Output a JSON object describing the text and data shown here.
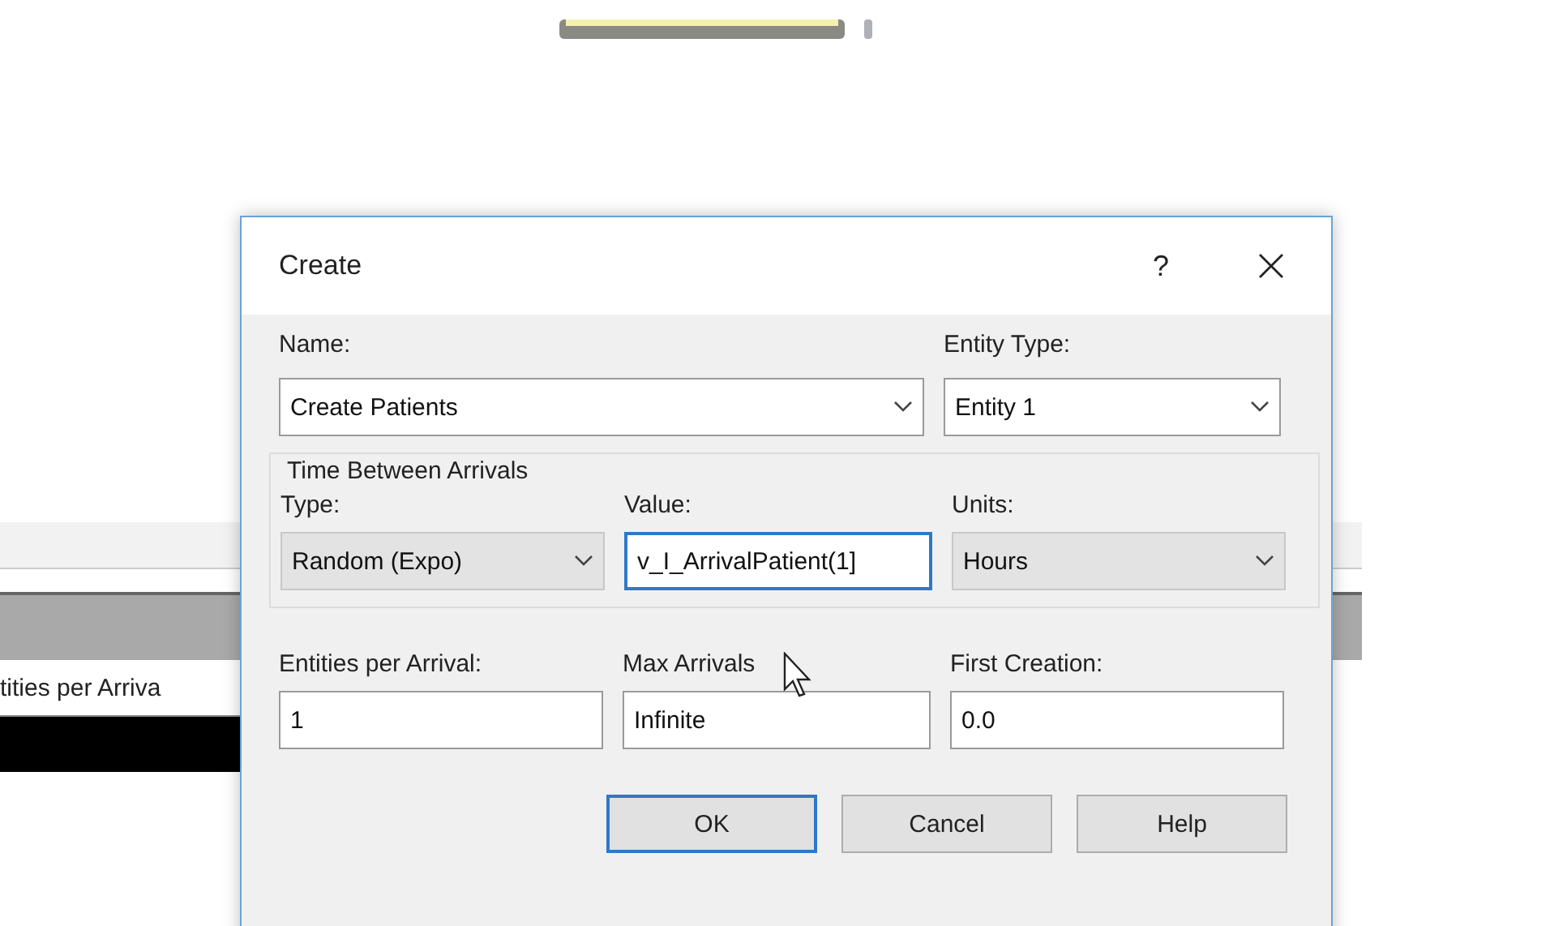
{
  "background": {
    "column_label": "tities per Arriva"
  },
  "dialog": {
    "title": "Create",
    "help": "?",
    "name": {
      "label": "Name:",
      "value": "Create Patients",
      "kind": "combo"
    },
    "entity_type": {
      "label": "Entity Type:",
      "value": "Entity 1",
      "kind": "combo"
    },
    "group": {
      "title": "Time Between Arrivals",
      "fields": [
        {
          "label": "Type:",
          "value": "Random (Expo)",
          "kind": "list",
          "focused": false
        },
        {
          "label": "Value:",
          "value": "v_I_ArrivalPatient(1]",
          "kind": "text",
          "focused": true
        },
        {
          "label": "Units:",
          "value": "Hours",
          "kind": "list",
          "focused": false
        }
      ]
    },
    "fields": [
      {
        "label": "Entities per Arrival:",
        "value": "1",
        "kind": "text",
        "focused": false
      },
      {
        "label": "Max Arrivals",
        "value": "Infinite",
        "kind": "text",
        "focused": false
      },
      {
        "label": "First Creation:",
        "value": "0.0",
        "kind": "text",
        "focused": false
      }
    ],
    "buttons": [
      {
        "label": "OK",
        "default": true
      },
      {
        "label": "Cancel",
        "default": false
      },
      {
        "label": "Help",
        "default": false
      }
    ]
  }
}
